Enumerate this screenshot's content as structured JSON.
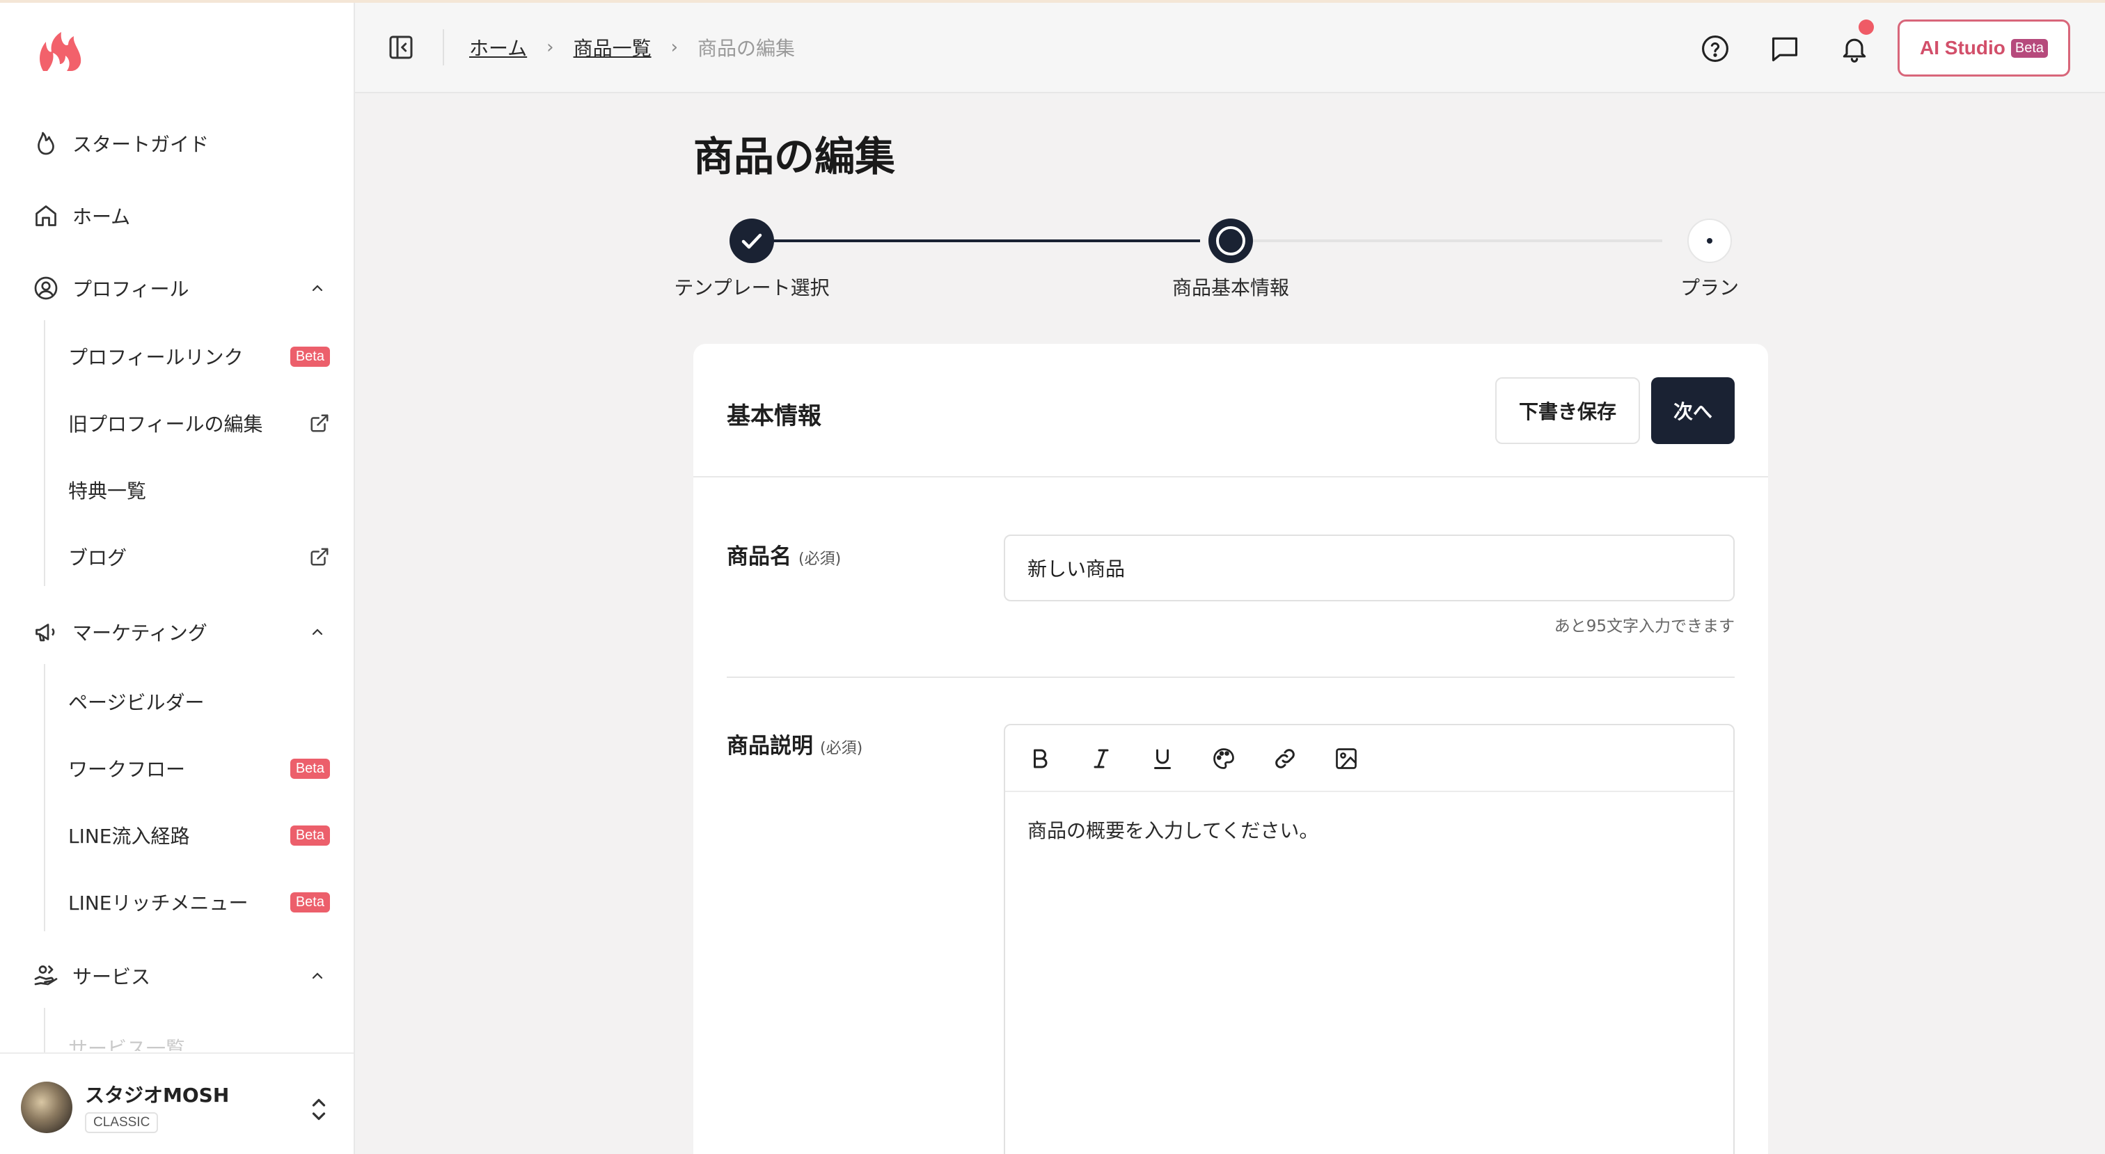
{
  "sidebar": {
    "nav": {
      "start_guide": "スタートガイド",
      "home": "ホーム",
      "profile": "プロフィール",
      "marketing": "マーケティング",
      "service": "サービス"
    },
    "profile_items": [
      {
        "label": "プロフィールリンク",
        "badge": "Beta"
      },
      {
        "label": "旧プロフィールの編集"
      },
      {
        "label": "特典一覧"
      },
      {
        "label": "ブログ"
      }
    ],
    "marketing_items": [
      {
        "label": "ページビルダー"
      },
      {
        "label": "ワークフロー",
        "badge": "Beta"
      },
      {
        "label": "LINE流入経路",
        "badge": "Beta"
      },
      {
        "label": "LINEリッチメニュー",
        "badge": "Beta"
      }
    ],
    "service_items": [
      {
        "label": "サービス一覧"
      }
    ],
    "account": {
      "name": "スタジオMOSH",
      "plan": "CLASSIC"
    }
  },
  "header": {
    "breadcrumb": [
      "ホーム",
      "商品一覧",
      "商品の編集"
    ],
    "ai_button": {
      "label": "AI Studio",
      "badge": "Beta"
    }
  },
  "page": {
    "title": "商品の編集"
  },
  "stepper": {
    "steps": [
      {
        "label": "テンプレート選択",
        "state": "done"
      },
      {
        "label": "商品基本情報",
        "state": "current"
      },
      {
        "label": "プラン",
        "state": "upcoming"
      }
    ]
  },
  "form": {
    "section_title": "基本情報",
    "draft_button": "下書き保存",
    "next_button": "次へ",
    "name_field": {
      "label": "商品名",
      "required": "(必須)",
      "value": "新しい商品",
      "counter": "あと95文字入力できます"
    },
    "description_field": {
      "label": "商品説明",
      "required": "(必須)",
      "placeholder": "商品の概要を入力してください。"
    }
  },
  "colors": {
    "accent": "#1a2233",
    "brand": "#ef5b66",
    "beta_badge": "#ec5f6b",
    "ai_border": "#d8667a"
  },
  "icons": [
    "flame-logo-icon",
    "flame-icon",
    "home-icon",
    "user-circle-icon",
    "megaphone-icon",
    "service-hand-icon",
    "chevron-up-icon",
    "external-link-icon",
    "sidebar-collapse-icon",
    "help-icon",
    "chat-icon",
    "bell-icon",
    "bold-icon",
    "italic-icon",
    "underline-icon",
    "palette-icon",
    "link-icon",
    "image-icon",
    "check-icon",
    "updown-chevron-icon"
  ]
}
